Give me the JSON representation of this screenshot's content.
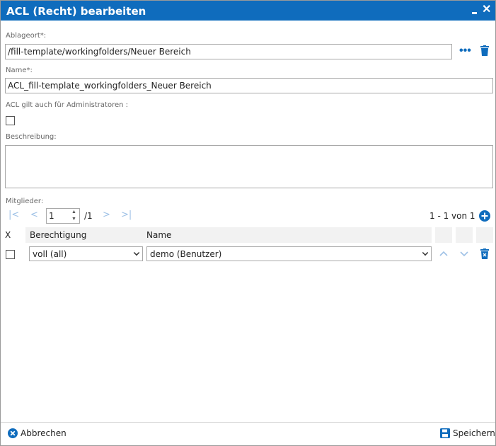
{
  "dialog": {
    "title": "ACL (Recht) bearbeiten",
    "close_glyph": "✕"
  },
  "form": {
    "location_label": "Ablageort*:",
    "location_value": "/fill-template/workingfolders/Neuer Bereich",
    "name_label": "Name*:",
    "name_value": "ACL_fill-template_workingfolders_Neuer Bereich",
    "admin_label": "ACL gilt auch für Administratoren :",
    "admin_checked": false,
    "description_label": "Beschreibung:",
    "description_value": "",
    "members_label": "Mitglieder:"
  },
  "pager": {
    "page_value": "1",
    "page_total": "/1",
    "range_text": "1 - 1 von 1"
  },
  "table": {
    "columns": [
      "X",
      "Berechtigung",
      "Name"
    ],
    "rows": [
      {
        "checked": false,
        "permission": "voll (all)",
        "name": "demo (Benutzer)"
      }
    ]
  },
  "footer": {
    "cancel_label": "Abbrechen",
    "save_label": "Speichern"
  },
  "colors": {
    "accent": "#0f6cbd",
    "disabled_icon": "#9ec1e6"
  },
  "icons": [
    "minimize-icon",
    "close-icon",
    "more-icon",
    "trash-icon",
    "first-page-icon",
    "prev-page-icon",
    "next-page-icon",
    "last-page-icon",
    "add-icon",
    "move-up-icon",
    "move-down-icon",
    "delete-row-icon",
    "cancel-icon",
    "save-icon"
  ]
}
